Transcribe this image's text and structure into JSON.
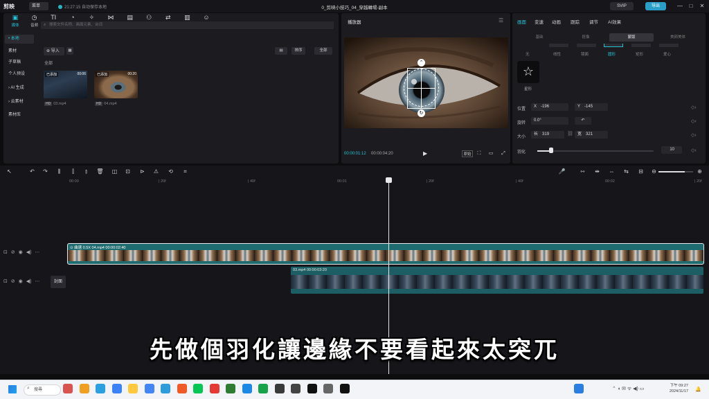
{
  "titlebar": {
    "logo": "剪映",
    "menu_label": "菜单",
    "autosave": "21:27:15 自动保存本地",
    "project_title": "0_剪映小技巧_04_穿越轉場-副本",
    "svip": "SVIP",
    "export": "导出",
    "win_min": "—",
    "win_max": "□",
    "win_close": "✕"
  },
  "media_tabs": [
    {
      "label": "媒体",
      "icon": "▣"
    },
    {
      "label": "音频",
      "icon": "◷"
    },
    {
      "label": "文本",
      "icon": "TI"
    },
    {
      "label": "贴纸",
      "icon": "◔"
    },
    {
      "label": "特效",
      "icon": "✧"
    },
    {
      "label": "转场",
      "icon": "⋈"
    },
    {
      "label": "字幕",
      "icon": "▤"
    },
    {
      "label": "滤镜",
      "icon": "⚇"
    },
    {
      "label": "调节",
      "icon": "⇄"
    },
    {
      "label": "模板",
      "icon": "▥"
    },
    {
      "label": "数字人",
      "icon": "☺"
    }
  ],
  "sidebar": [
    {
      "label": "• 本地"
    },
    {
      "label": "素材"
    },
    {
      "label": "子草稿"
    },
    {
      "label": "个人预设"
    },
    {
      "label": "› AI 生成"
    },
    {
      "label": "› 云素材"
    },
    {
      "label": "素材库"
    }
  ],
  "media": {
    "search_placeholder": "搜索文件名称、画面元素、台词",
    "import": "⊕ 导入",
    "sort": "排序",
    "all": "全部",
    "section": "全部",
    "items": [
      {
        "tag": "已添加",
        "duration": "00:06",
        "file": "03.mp4",
        "badge": "HD"
      },
      {
        "tag": "已添加",
        "duration": "00:20",
        "file": "04.mp4",
        "badge": "HD"
      }
    ]
  },
  "player": {
    "title": "播放器",
    "menu_icon": "☰",
    "timecode": "00:00:01:12",
    "total": "00:00:04:20",
    "play_icon": "▶",
    "ratio": "原始",
    "ctl_icons": [
      "▦",
      "⛶",
      "▭",
      "⤢"
    ]
  },
  "props": {
    "tabs": [
      "画面",
      "变速",
      "动画",
      "跟踪",
      "调节",
      "AI效果"
    ],
    "subtabs": [
      "基础",
      "抠像",
      "蒙版",
      "美颜美体"
    ],
    "mask_shapes": [
      "无",
      "线性",
      "镜面",
      "圆形",
      "矩形",
      "爱心"
    ],
    "star_label": "星形",
    "pos_label": "位置",
    "x_label": "X",
    "x_value": "-196",
    "y_label": "Y",
    "y_value": "-145",
    "rot_label": "旋转",
    "rot_value": "0.0°",
    "rot_btn": "↶",
    "size_label": "大小",
    "w_label": "长",
    "w_value": "319",
    "h_label": "宽",
    "h_value": "321",
    "feather_label": "羽化",
    "feather_value": "10",
    "feather_level": 0.12
  },
  "toolbar2": {
    "icons": [
      "↖",
      "↶",
      "↷",
      "⫼",
      "⫿",
      "⫾",
      "🗑",
      "◫",
      "⊡",
      "⊳",
      "⚠",
      "⟲",
      "⌗"
    ],
    "right_icons": [
      "🎤",
      "⇿",
      "⇹",
      "⇔",
      "⇆",
      "⊟",
      "⊖",
      "⊕"
    ],
    "zoom_level": 0.75
  },
  "ruler": [
    "00:00",
    "| 20f",
    "| 40f",
    "00:01",
    "| 20f",
    "| 40f",
    "00:02",
    "| 20f"
  ],
  "tracks": {
    "main": {
      "caption": "⊙ 曲速 0.5X  04.mp4  00:00:02:40"
    },
    "second": {
      "caption": "03.mp4  00:00:03:20"
    },
    "cover": "封面",
    "ctrl_icons": [
      "⊡",
      "⊘",
      "◉",
      "◀)",
      "⋯"
    ]
  },
  "subtitle": "先做個羽化讓邊緣不要看起來太突兀",
  "taskbar": {
    "search": "搜尋",
    "time": "下午 09:27",
    "date": "2024/11/17"
  }
}
